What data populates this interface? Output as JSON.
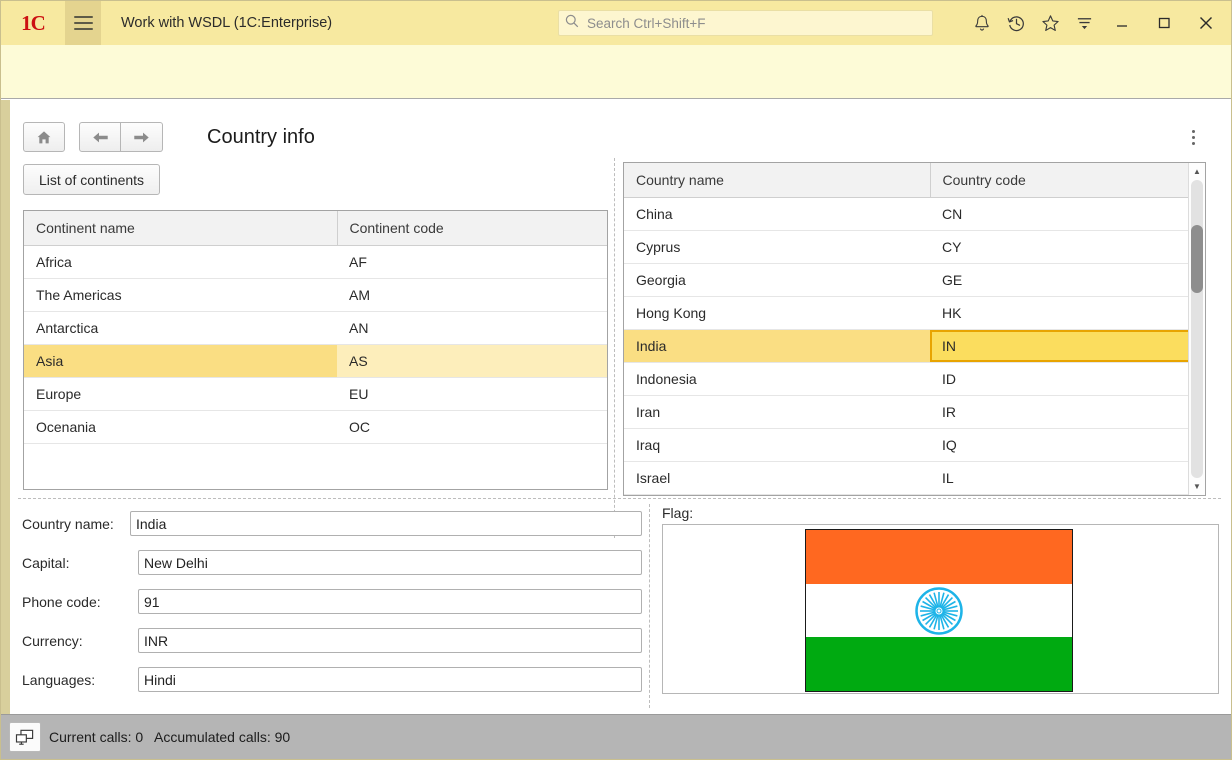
{
  "window": {
    "logo_text": "1C",
    "title": "Work with WSDL  (1C:Enterprise)",
    "search_placeholder": "Search Ctrl+Shift+F",
    "search_value": "",
    "icons": {
      "menu": "hamburger-menu-icon",
      "search": "search-icon",
      "notifications": "bell-icon",
      "history": "history-clock-icon",
      "favorites": "star-icon",
      "filter": "funnel-sort-icon",
      "minimize": "minimize-icon",
      "maximize": "maximize-icon",
      "close": "close-icon"
    }
  },
  "nav": {
    "home_icon": "home-icon",
    "back_icon": "arrow-left-icon",
    "forward_icon": "arrow-right-icon",
    "more_icon": "kebab-menu-icon",
    "page_title": "Country info",
    "list_button": "List of continents"
  },
  "continents": {
    "columns": [
      "Continent name",
      "Continent code"
    ],
    "selected_row": 3,
    "rows": [
      {
        "name": "Africa",
        "code": "AF"
      },
      {
        "name": "The Americas",
        "code": "AM"
      },
      {
        "name": "Antarctica",
        "code": "AN"
      },
      {
        "name": "Asia",
        "code": "AS"
      },
      {
        "name": "Europe",
        "code": "EU"
      },
      {
        "name": "Ocenania",
        "code": "OC"
      }
    ]
  },
  "countries": {
    "columns": [
      "Country name",
      "Country code"
    ],
    "selected_row": 4,
    "focused_cell": "code",
    "rows": [
      {
        "name": "China",
        "code": "CN"
      },
      {
        "name": "Cyprus",
        "code": "CY"
      },
      {
        "name": "Georgia",
        "code": "GE"
      },
      {
        "name": "Hong Kong",
        "code": "HK"
      },
      {
        "name": "India",
        "code": "IN"
      },
      {
        "name": "Indonesia",
        "code": "ID"
      },
      {
        "name": "Iran",
        "code": "IR"
      },
      {
        "name": "Iraq",
        "code": "IQ"
      },
      {
        "name": "Israel",
        "code": "IL"
      }
    ]
  },
  "form": {
    "fields": [
      {
        "label": "Country name:",
        "value": "India"
      },
      {
        "label": "Capital:",
        "value": "New Delhi"
      },
      {
        "label": "Phone code:",
        "value": "91"
      },
      {
        "label": "Currency:",
        "value": "INR"
      },
      {
        "label": "Languages:",
        "value": "Hindi"
      }
    ]
  },
  "flag": {
    "label": "Flag:",
    "alt": "flag-of-india",
    "colors": {
      "saffron": "#ff6820",
      "white": "#ffffff",
      "green": "#00aa11",
      "chakra": "#1eb4e8"
    }
  },
  "statusbar": {
    "icon": "network-monitor-icon",
    "text": "Current calls: 0   Accumulated calls: 90"
  },
  "theme": {
    "titlebar_bg": "#f7e9a0",
    "subbar_bg": "#fdfbd7",
    "selection_bg": "#fade83",
    "selection_row_bg": "#fdeebb",
    "focus_border": "#e8a400",
    "statusbar_bg": "#b5b5b5"
  }
}
